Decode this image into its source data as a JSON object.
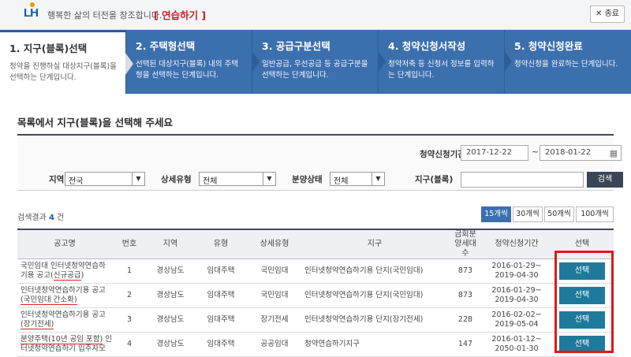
{
  "header": {
    "logo": "LH",
    "slogan": "행복한 삶의 터전을 창조합니다.",
    "practice": "[ 연습하기 ]",
    "close_label": "✕ 종료"
  },
  "steps": [
    {
      "title": "1. 지구(블록)선택",
      "desc": "청약을 진행하실 대상지구(블록)을 선택하는 단계입니다."
    },
    {
      "title": "2. 주택형선택",
      "desc": "선택된 대상지구(블록) 내의 주택형을 선택하는 단계입니다."
    },
    {
      "title": "3. 공급구분선택",
      "desc": "일반공급, 우선공급 등 공급구분을 선택하는 단계입니다."
    },
    {
      "title": "4. 청약신청서작성",
      "desc": "청약저축 등 신청서 정보를 입력하는 단계입니다."
    },
    {
      "title": "5. 청약신청완료",
      "desc": "청약신청을 완료하는 단계입니다."
    }
  ],
  "page_title": "목록에서 지구(블록)을 선택해 주세요",
  "filter": {
    "period_label": "청약신청기간",
    "date_from": "2017-12-22",
    "date_sep": "~",
    "date_to": "2018-01-22",
    "region_label": "지역",
    "region_value": "전국",
    "detail_type_label": "상세유형",
    "detail_type_value": "전체",
    "sale_status_label": "분양상태",
    "sale_status_value": "전체",
    "block_label": "지구(블록)",
    "block_value": "",
    "search_label": "검색"
  },
  "results": {
    "prefix": "검색결과",
    "count": "4",
    "suffix": "건",
    "page_sizes": [
      "15개씩",
      "30개씩",
      "50개씩",
      "100개씩"
    ]
  },
  "table": {
    "headers": [
      "공고명",
      "번호",
      "지역",
      "유형",
      "상세유형",
      "지구",
      "금회분양세대수",
      "청약신청기간",
      "선택"
    ],
    "rows": [
      {
        "title_a": "국민임대 인터넷청약연습하기용 공고(",
        "title_u": "신규공급",
        "title_b": ")",
        "no": "1",
        "region": "경상남도",
        "type": "임대주택",
        "detail": "국민임대",
        "block": "인터넷청약연습하기용 단지(국민임대)",
        "units": "873",
        "period_a": "2016-01-29~",
        "period_b": "2019-04-30",
        "action": "선택"
      },
      {
        "title_a": "인터넷청약연습하기용 공고",
        "title_u": "(국민임대 간소화)",
        "title_b": "",
        "no": "2",
        "region": "경상남도",
        "type": "임대주택",
        "detail": "국민임대",
        "block": "인터넷청약연습하기용 단지(국민임대)",
        "units": "873",
        "period_a": "2016-01-29~",
        "period_b": "2019-04-30",
        "action": "선택"
      },
      {
        "title_a": "인터넷청약연습하기용 공고",
        "title_u": "(장기전세)",
        "title_b": "",
        "no": "3",
        "region": "경상남도",
        "type": "임대주택",
        "detail": "장기전세",
        "block": "인터넷청약연습하기용 단지(장기전세)",
        "units": "228",
        "period_a": "2016-02-02~",
        "period_b": "2019-05-04",
        "action": "선택"
      },
      {
        "title_a": "",
        "title_u": "분양주택(10년 공임 포함)",
        "title_b": " 인터넷청약연습하기 입주자모",
        "no": "4",
        "region": "경상남도",
        "type": "임대주택",
        "detail": "공공임대",
        "block": "청약연습하기지구",
        "units": "147",
        "period_a": "2016-01-12~",
        "period_b": "2050-01-30",
        "action": "선택"
      }
    ]
  }
}
